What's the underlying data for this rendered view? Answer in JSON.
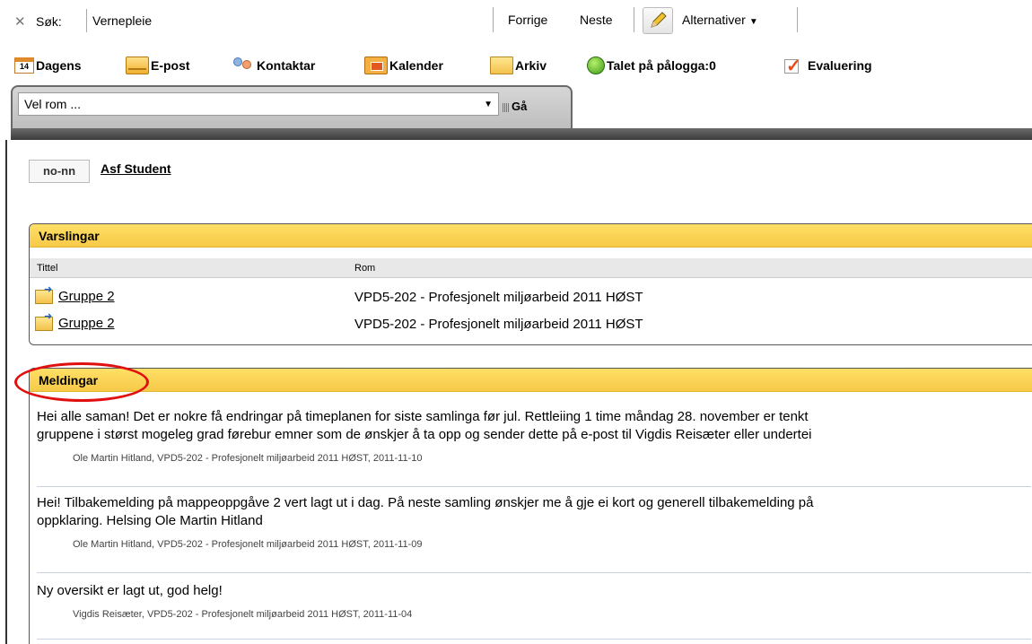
{
  "findbar": {
    "search_label": "Søk:",
    "search_value": "Vernepleie",
    "prev_label": "Forrige",
    "next_label": "Neste",
    "options_label": "Alternativer"
  },
  "toolbar": {
    "items": [
      {
        "label": "Dagens",
        "icon": "calendar-day-icon",
        "badge": "14"
      },
      {
        "label": "E-post",
        "icon": "mail-icon"
      },
      {
        "label": "Kontaktar",
        "icon": "contacts-icon"
      },
      {
        "label": "Kalender",
        "icon": "calendar-icon"
      },
      {
        "label": "Arkiv",
        "icon": "folder-icon"
      },
      {
        "label": "Talet på pålogga:0",
        "icon": "smiley-icon"
      },
      {
        "label": "Evaluering",
        "icon": "checkmark-icon"
      }
    ]
  },
  "room": {
    "select_value": "Vel rom ...",
    "go_label": "Gå"
  },
  "user": {
    "lang": "no-nn",
    "name": "Asf Student"
  },
  "varslingar": {
    "title": "Varslingar",
    "col_title": "Tittel",
    "col_room": "Rom",
    "rows": [
      {
        "title": "Gruppe 2",
        "room": "VPD5-202 - Profesjonelt miljøarbeid 2011 HØST"
      },
      {
        "title": "Gruppe 2",
        "room": "VPD5-202 - Profesjonelt miljøarbeid 2011 HØST"
      }
    ]
  },
  "meldingar": {
    "title": "Meldingar",
    "messages": [
      {
        "line1": "Hei alle saman! Det er nokre få endringar på timeplanen for siste samlinga før jul. Rettleiing 1 time måndag 28. november er tenkt",
        "line2": "gruppene i størst mogeleg grad førebur emner som de ønskjer å ta opp og sender dette på e-post til Vigdis Reisæter eller undertei",
        "meta": "Ole Martin Hitland,  VPD5-202 - Profesjonelt miljøarbeid 2011 HØST,  2011-11-10"
      },
      {
        "line1": "Hei! Tilbakemelding på mappeoppgåve 2 vert lagt ut i dag. På neste samling ønskjer me å gje ei kort og generell tilbakemelding på",
        "line2": "oppklaring. Helsing Ole Martin Hitland",
        "meta": "Ole Martin Hitland,  VPD5-202 - Profesjonelt miljøarbeid 2011 HØST,  2011-11-09"
      },
      {
        "line1": "Ny oversikt er lagt ut, god helg!",
        "line2": "",
        "meta": "Vigdis Reisæter,  VPD5-202 - Profesjonelt miljøarbeid 2011 HØST,  2011-11-04"
      }
    ]
  },
  "colors": {
    "panel_header": "#f7c948",
    "annotation": "#e01010"
  }
}
